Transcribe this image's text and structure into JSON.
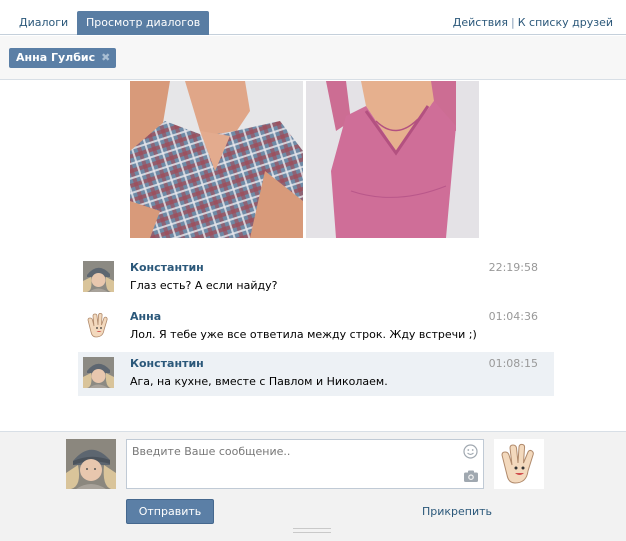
{
  "tabs": [
    {
      "label": "Диалоги",
      "active": false
    },
    {
      "label": "Просмотр диалогов",
      "active": true
    }
  ],
  "header_links": {
    "actions": "Действия",
    "separator": "|",
    "friends": "К списку друзей"
  },
  "peer": {
    "name": "Анна Гулбис",
    "remove_glyph": "✖"
  },
  "messages": [
    {
      "author": "Константин",
      "text": "Глаз есть? А если найду?",
      "time": "22:19:58",
      "avatar_icon": "user-avatar-photo"
    },
    {
      "author": "Анна",
      "text": "Лол. Я тебе уже все ответила между строк. Жду встречи ;)",
      "time": "01:04:36",
      "avatar_icon": "waving-hand-avatar"
    },
    {
      "author": "Константин",
      "text": "Ага, на кухне, вместе с Павлом и Николаем.",
      "time": "01:08:15",
      "avatar_icon": "user-avatar-photo",
      "highlighted": true
    }
  ],
  "composer": {
    "placeholder": "Введите Ваше сообщение..",
    "send_label": "Отправить",
    "attach_label": "Прикрепить"
  },
  "icons": [
    "smile-icon",
    "camera-icon",
    "close-icon"
  ],
  "colors": {
    "accent": "#597da3",
    "link": "#2b587a",
    "highlight_row": "#edf1f5",
    "time_gray": "#999999"
  }
}
